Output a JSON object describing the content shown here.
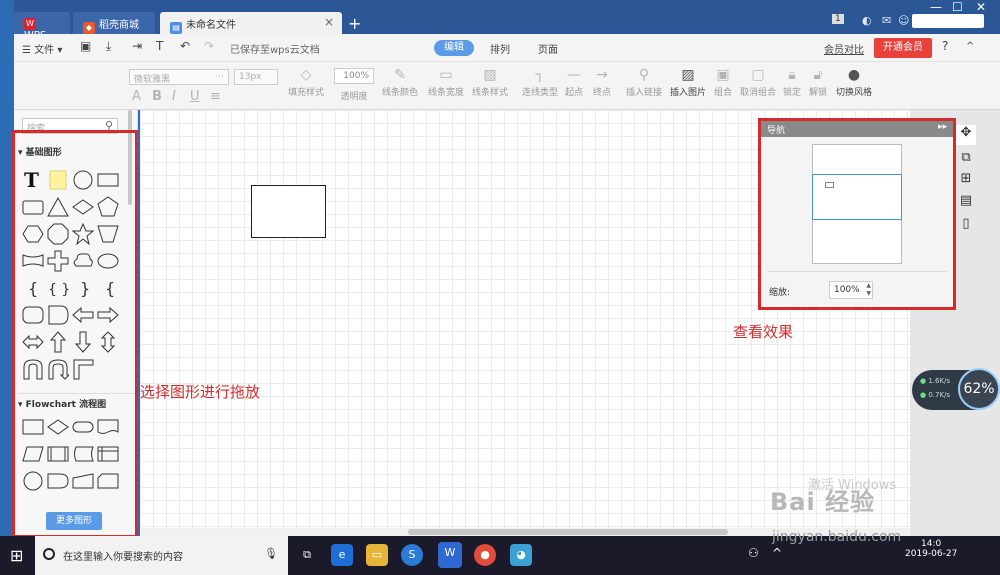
{
  "tabs": [
    {
      "label": "WPS"
    },
    {
      "label": "稻壳商城"
    },
    {
      "label": "未命名文件",
      "close": "×"
    }
  ],
  "new_tab": "+",
  "title_right_badge": "1",
  "menubar": {
    "file_menu": "文件",
    "saved_status": "已保存至wps云文档",
    "view_tabs": [
      "编辑",
      "排列",
      "页面"
    ],
    "compare": "会员对比",
    "vip_button": "开通会员",
    "help": "?",
    "collapse": "^"
  },
  "toolbar": {
    "font_placeholder": "微软雅黑",
    "size_placeholder": "13px",
    "opacity_value": "100%",
    "buttons": [
      "填充样式",
      "透明度",
      "线条颜色",
      "线条宽度",
      "线条样式",
      "连线类型",
      "起点",
      "终点",
      "插入链接",
      "插入图片",
      "组合",
      "取消组合",
      "锁定",
      "解锁",
      "切换风格"
    ]
  },
  "left_panel": {
    "search_placeholder": "搜索",
    "section_basic": "基础图形",
    "section_flowchart": "Flowchart 流程图",
    "more_button": "更多图形"
  },
  "nav_panel": {
    "title": "导航",
    "zoom_label": "缩放:",
    "zoom_value": "100%"
  },
  "annotations": {
    "left": "选择图形进行拖放",
    "right": "查看效果"
  },
  "watermark": {
    "activate": "激活 Windows",
    "baidu": "Bai 经验",
    "url": "jingyan.baidu.com"
  },
  "network": {
    "up": "1.6K/s",
    "down": "0.7K/s",
    "percent": "62%"
  },
  "taskbar": {
    "search_text": "在这里输入你要搜索的内容",
    "date": "2019-06-27",
    "time": "14:0"
  },
  "colors": {
    "accent": "#5a9ae6",
    "vip": "#e8413c",
    "annotation": "#d62b2b",
    "titlebar": "#2b5797"
  }
}
